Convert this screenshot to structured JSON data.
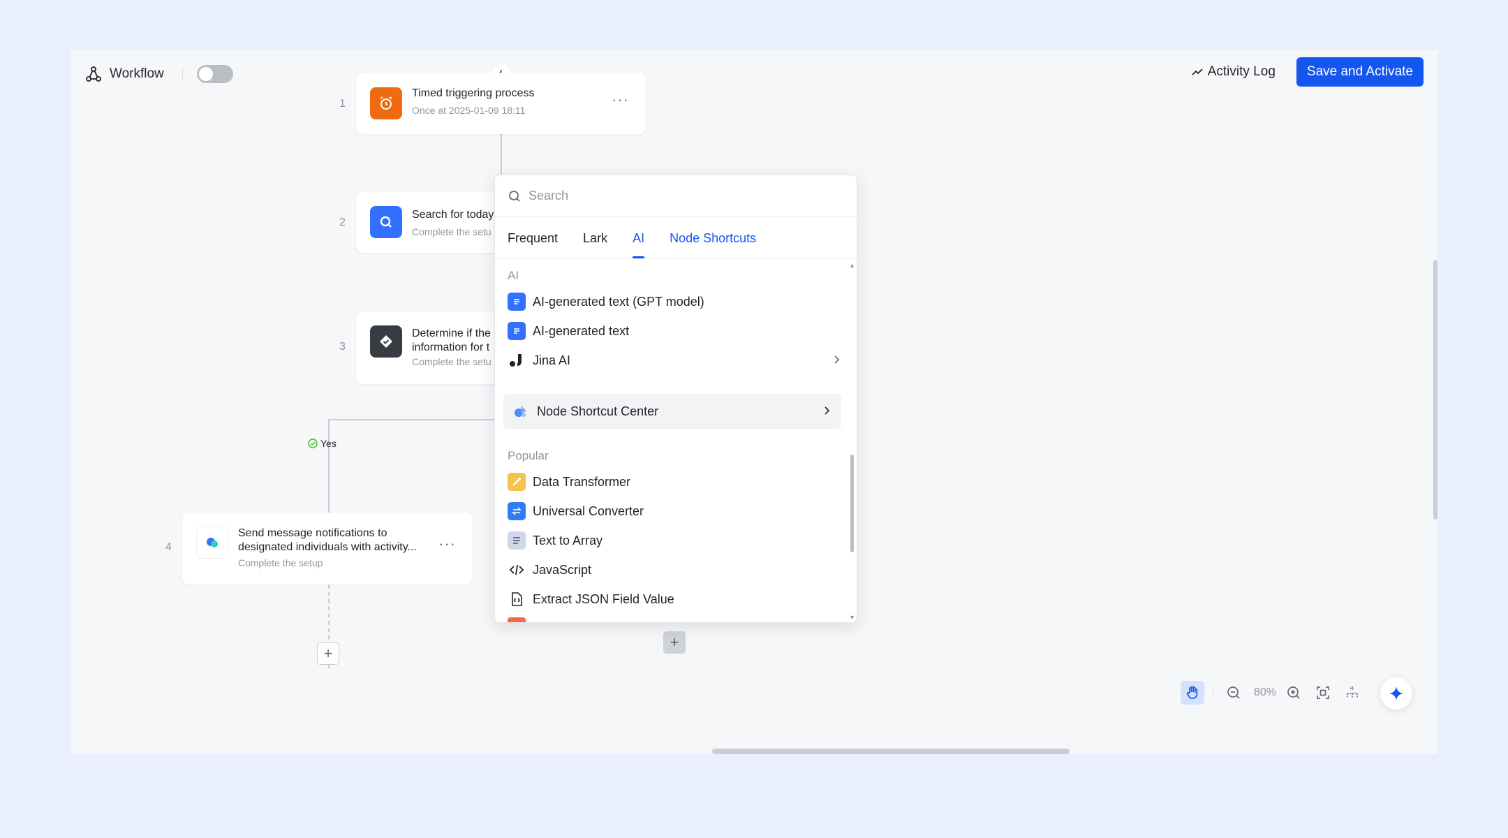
{
  "topbar": {
    "title": "Workflow",
    "activity_label": "Activity Log",
    "save_label": "Save and Activate"
  },
  "nodes": [
    {
      "step": "1",
      "title": "Timed triggering process",
      "subtitle": "Once at 2025-01-09 18:11",
      "icon": "alarm-clock-icon",
      "color": "#f06a0f"
    },
    {
      "step": "2",
      "title": "Search for today",
      "subtitle": "Complete the setu",
      "icon": "search-icon",
      "color": "#3370ff"
    },
    {
      "step": "3",
      "title": "Determine if the\ninformation for t",
      "subtitle": "Complete the setu",
      "icon": "condition-check-icon",
      "color": "#373c43"
    },
    {
      "step": "4",
      "title": "Send message notifications to\ndesignated individuals with activity...",
      "subtitle": "Complete the setup",
      "icon": "lark-messenger-icon",
      "color": "#ffffff"
    }
  ],
  "branch": {
    "yes_label": "Yes"
  },
  "panel": {
    "search_placeholder": "Search",
    "tabs": [
      "Frequent",
      "Lark",
      "AI",
      "Node Shortcuts"
    ],
    "active_tab": "AI",
    "section_ai": "AI",
    "ai_items": [
      {
        "label": "AI-generated text (GPT model)",
        "icon": "gpt-text-icon"
      },
      {
        "label": "AI-generated text",
        "icon": "ai-text-icon"
      },
      {
        "label": "Jina AI",
        "icon": "jina-ai-icon"
      }
    ],
    "shortcut_center": "Node Shortcut Center",
    "section_popular": "Popular",
    "popular_items": [
      {
        "label": "Data Transformer",
        "icon": "data-transformer-icon"
      },
      {
        "label": "Universal Converter",
        "icon": "universal-converter-icon"
      },
      {
        "label": "Text to Array",
        "icon": "text-to-array-icon"
      },
      {
        "label": "JavaScript",
        "icon": "code-icon"
      },
      {
        "label": "Extract JSON Field Value",
        "icon": "json-file-icon"
      }
    ]
  },
  "zoom": {
    "level": "80%"
  },
  "colors": {
    "accent": "#1456f0",
    "canvas": "#f6f7f9",
    "backdrop": "#e9effc"
  }
}
